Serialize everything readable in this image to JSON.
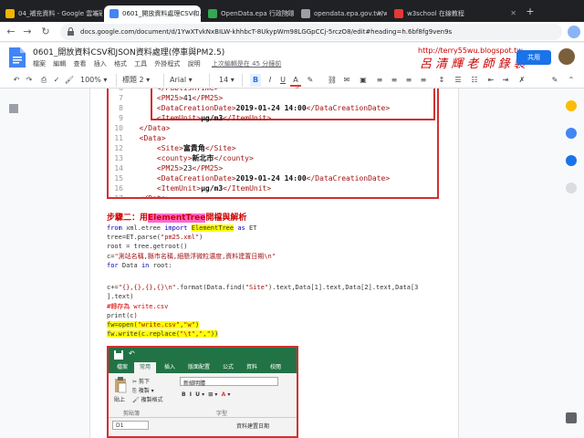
{
  "tabs": [
    {
      "title": "04_補充資料 - Google 雲端硬碟",
      "active": false
    },
    {
      "title": "0601_開放資料處理CSV和...",
      "active": true
    },
    {
      "title": "OpenData.epa 行政院環保...",
      "active": false
    },
    {
      "title": "opendata.epa.gov.tw/ws/...",
      "active": false
    },
    {
      "title": "w3school 在線教程",
      "active": false
    }
  ],
  "address": {
    "url": "docs.google.com/document/d/1YwXTvkNxBILW-khhbcT-8UkypWm98LGGpCCj-5rczO8/edit#heading=h.6bf8fg9ven9s"
  },
  "doc": {
    "title": "0601_開放資料CSV和JSON資料處理(停車與PM2.5)",
    "menus": [
      "檔案",
      "編輯",
      "查看",
      "插入",
      "格式",
      "工具",
      "外掛程式",
      "說明"
    ],
    "last_edit": "上次編輯是在 45 分鐘前",
    "share_label": "共用",
    "watermark": "呂 清 輝 老 師 錄 製",
    "watermark_url": "http://terry55wu.blogspot.tw"
  },
  "toolbar": {
    "zoom": "100%",
    "style": "標題 2",
    "font": "Arial",
    "size": "14",
    "bold": "B",
    "italic": "I",
    "underline": "U",
    "text_color": "A"
  },
  "xml_lines": [
    {
      "n": "6",
      "kind": "close-partial",
      "text": "<PublishTime>"
    },
    {
      "n": "7",
      "kind": "pm",
      "text": "41"
    },
    {
      "n": "8",
      "kind": "date",
      "text": "2019-01-24 14:00"
    },
    {
      "n": "9",
      "kind": "unit",
      "text": "μg/m3"
    },
    {
      "n": "10",
      "kind": "close-data"
    },
    {
      "n": "11",
      "kind": "open-data"
    },
    {
      "n": "12",
      "kind": "site",
      "text": "富貴角"
    },
    {
      "n": "13",
      "kind": "county",
      "text": "新北市"
    },
    {
      "n": "14",
      "kind": "pm",
      "text": "23"
    },
    {
      "n": "15",
      "kind": "date",
      "text": "2019-01-24 14:00"
    },
    {
      "n": "16",
      "kind": "unit",
      "text": "μg/m3"
    },
    {
      "n": "17",
      "kind": "close-data"
    }
  ],
  "step": {
    "prefix": "步驟二：用",
    "highlight": "ElementTree",
    "suffix": "開檔與解析"
  },
  "code_lines": [
    "from xml.etree import ElementTree as ET",
    "tree=ET.parse(\"pm25.xml\")",
    "root = tree.getroot()",
    "c=\"測站名稱,縣市名稱,細懸浮微粒濃度,資料建置日期\\n\"",
    "for Data in root:",
    "",
    "c+=\"{},{},{},{}\\n\".format(Data.find(\"Site\").text,Data[1].text,Data[2].text,Data[3",
    "].text)",
    "#轉存為 write.csv",
    "print(c)",
    "fw=open(\"write.csv\",\"w\")",
    "fw.write(c.replace(\"\\t\",\",\"))"
  ],
  "excel": {
    "tabs": [
      "檔案",
      "常用",
      "插入",
      "版面配置",
      "公式",
      "資料",
      "校閱"
    ],
    "cut": "剪下",
    "copy": "複製",
    "format_painter": "複製格式",
    "paste": "貼上",
    "clipboard": "剪貼簿",
    "font_name": "新細明體",
    "font_group": "字型",
    "cell": "D1",
    "header_cell": "資料建置日期"
  },
  "colors": {
    "accent_red": "#d32f2f",
    "highlight_yellow": "#ffff00",
    "highlight_pink": "#ff69c8",
    "excel_green": "#217346",
    "docs_blue": "#1a73e8"
  }
}
